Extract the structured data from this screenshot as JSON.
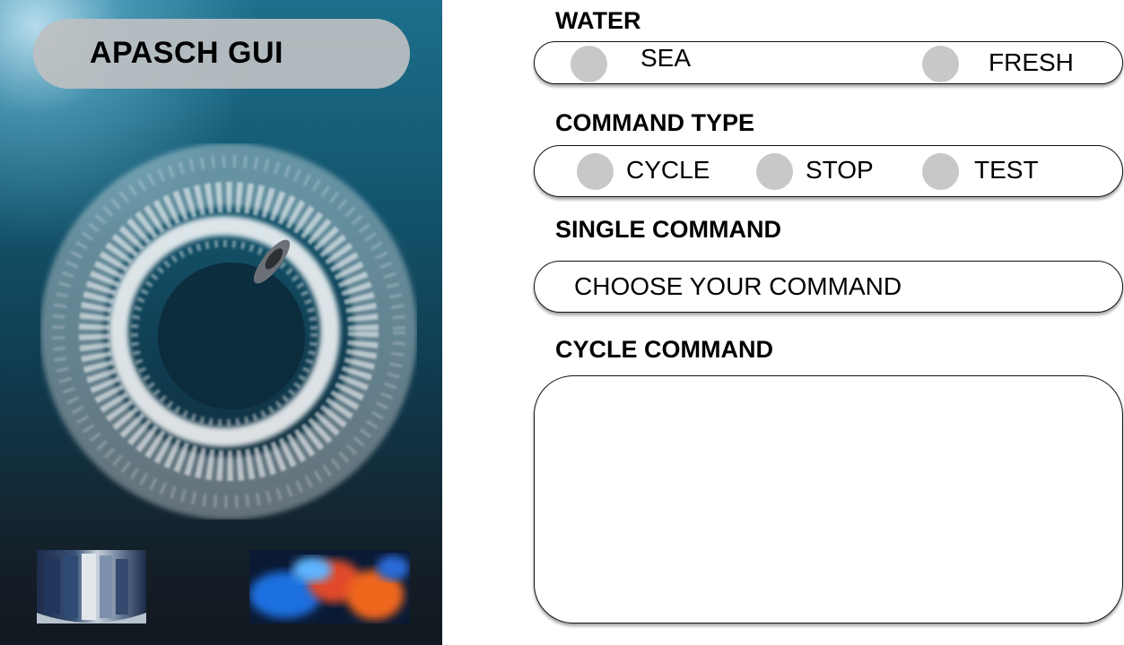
{
  "app": {
    "title": "APASCH GUI"
  },
  "hero": {
    "image": "aerial-boat-wake-photo",
    "thumbnails": [
      "library-architecture-thumbnail",
      "colorful-smoke-thumbnail"
    ]
  },
  "water": {
    "label": "WATER",
    "options": [
      {
        "label": "SEA"
      },
      {
        "label": "FRESH"
      }
    ]
  },
  "command_type": {
    "label": "COMMAND TYPE",
    "options": [
      {
        "label": "CYCLE"
      },
      {
        "label": "STOP"
      },
      {
        "label": "TEST"
      }
    ]
  },
  "single_command": {
    "label": "SINGLE COMMAND",
    "selected": "CHOOSE YOUR COMMAND"
  },
  "cycle_command": {
    "label": "CYCLE COMMAND",
    "value": ""
  },
  "colors": {
    "radio_fill": "#c8c8c8",
    "title_pill": "#bcc0c2",
    "ocean_dark": "#12181f",
    "ocean_light": "#1d6f8c"
  }
}
